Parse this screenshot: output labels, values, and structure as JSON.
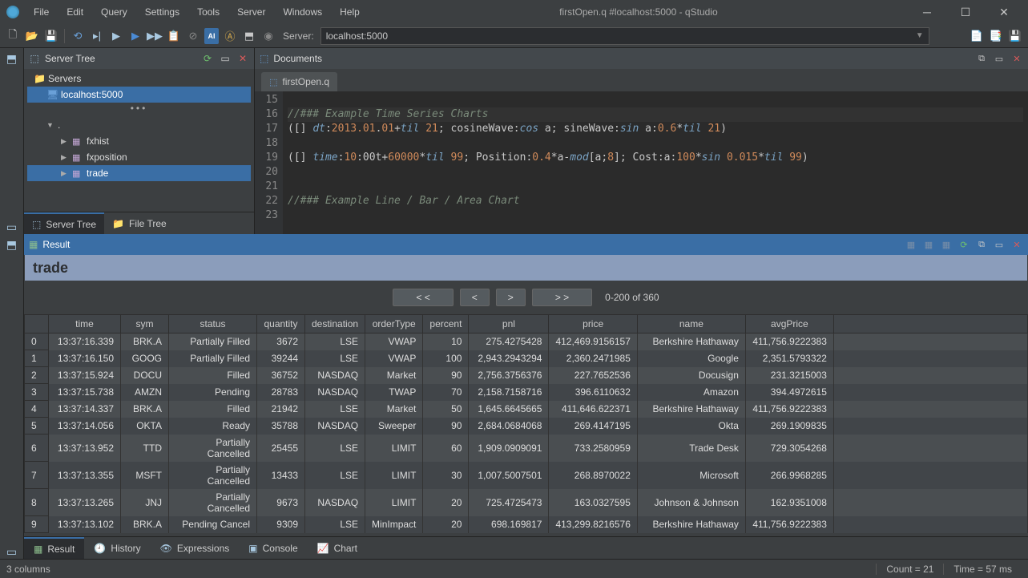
{
  "window": {
    "title": "firstOpen.q #localhost:5000 - qStudio"
  },
  "menu": [
    "File",
    "Edit",
    "Query",
    "Settings",
    "Tools",
    "Server",
    "Windows",
    "Help"
  ],
  "toolbar": {
    "server_label": "Server:",
    "server_value": "localhost:5000"
  },
  "serverPanel": {
    "title": "Server Tree",
    "root": "Servers",
    "server": "localhost:5000",
    "tables": [
      "fxhist",
      "fxposition",
      "trade"
    ],
    "tabs": {
      "serverTree": "Server Tree",
      "fileTree": "File Tree"
    }
  },
  "documents": {
    "title": "Documents",
    "tab": "firstOpen.q",
    "lineStart": 15,
    "lines": [
      "",
      "//### Example Time Series Charts",
      "([] dt:2013.01.01+til 21; cosineWave:cos a; sineWave:sin a:0.6*til 21)",
      "",
      "([] time:10:00t+60000*til 99; Position:0.4*a-mod[a;8]; Cost:a:100*sin 0.015*til 99)",
      "",
      "",
      "//### Example Line / Bar / Area Chart",
      ""
    ]
  },
  "result": {
    "title": "Result",
    "tableTitle": "trade",
    "pager": {
      "first": "< <",
      "prev": "<",
      "next": ">",
      "last": "> >",
      "info": "0-200 of 360"
    },
    "columns": [
      "time",
      "sym",
      "status",
      "quantity",
      "destination",
      "orderType",
      "percent",
      "pnl",
      "price",
      "name",
      "avgPrice"
    ],
    "rows": [
      [
        "0",
        "13:37:16.339",
        "BRK.A",
        "Partially Filled",
        "3672",
        "LSE",
        "VWAP",
        "10",
        "275.4275428",
        "412,469.9156157",
        "Berkshire Hathaway",
        "411,756.9222383"
      ],
      [
        "1",
        "13:37:16.150",
        "GOOG",
        "Partially Filled",
        "39244",
        "LSE",
        "VWAP",
        "100",
        "2,943.2943294",
        "2,360.2471985",
        "Google",
        "2,351.5793322"
      ],
      [
        "2",
        "13:37:15.924",
        "DOCU",
        "Filled",
        "36752",
        "NASDAQ",
        "Market",
        "90",
        "2,756.3756376",
        "227.7652536",
        "Docusign",
        "231.3215003"
      ],
      [
        "3",
        "13:37:15.738",
        "AMZN",
        "Pending",
        "28783",
        "NASDAQ",
        "TWAP",
        "70",
        "2,158.7158716",
        "396.6110632",
        "Amazon",
        "394.4972615"
      ],
      [
        "4",
        "13:37:14.337",
        "BRK.A",
        "Filled",
        "21942",
        "LSE",
        "Market",
        "50",
        "1,645.6645665",
        "411,646.622371",
        "Berkshire Hathaway",
        "411,756.9222383"
      ],
      [
        "5",
        "13:37:14.056",
        "OKTA",
        "Ready",
        "35788",
        "NASDAQ",
        "Sweeper",
        "90",
        "2,684.0684068",
        "269.4147195",
        "Okta",
        "269.1909835"
      ],
      [
        "6",
        "13:37:13.952",
        "TTD",
        "Partially Cancelled",
        "25455",
        "LSE",
        "LIMIT",
        "60",
        "1,909.0909091",
        "733.2580959",
        "Trade Desk",
        "729.3054268"
      ],
      [
        "7",
        "13:37:13.355",
        "MSFT",
        "Partially Cancelled",
        "13433",
        "LSE",
        "LIMIT",
        "30",
        "1,007.5007501",
        "268.8970022",
        "Microsoft",
        "266.9968285"
      ],
      [
        "8",
        "13:37:13.265",
        "JNJ",
        "Partially Cancelled",
        "9673",
        "NASDAQ",
        "LIMIT",
        "20",
        "725.4725473",
        "163.0327595",
        "Johnson & Johnson",
        "162.9351008"
      ],
      [
        "9",
        "13:37:13.102",
        "BRK.A",
        "Pending Cancel",
        "9309",
        "LSE",
        "MinImpact",
        "20",
        "698.169817",
        "413,299.8216576",
        "Berkshire Hathaway",
        "411,756.9222383"
      ]
    ],
    "tabs": {
      "result": "Result",
      "history": "History",
      "expressions": "Expressions",
      "console": "Console",
      "chart": "Chart"
    }
  },
  "status": {
    "left": "3 columns",
    "count": "Count = 21",
    "time": "Time = 57 ms"
  }
}
